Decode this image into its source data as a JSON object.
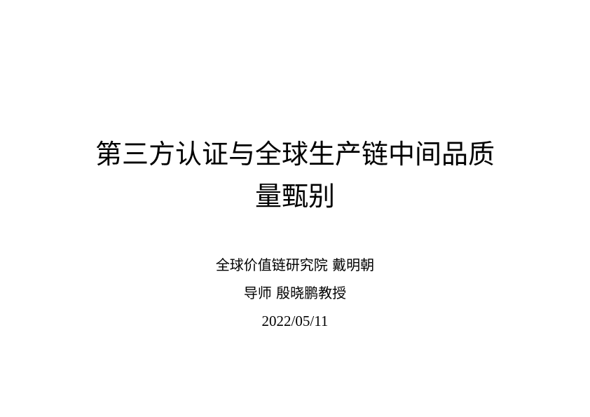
{
  "slide": {
    "title_line_1": "第三方认证与全球生产链中间品质",
    "title_line_2": "量甄别",
    "affiliation_line": "全球价值链研究院 戴明朝",
    "advisor_line": "导师 殷晓鹏教授",
    "date": "2022/05/11"
  }
}
